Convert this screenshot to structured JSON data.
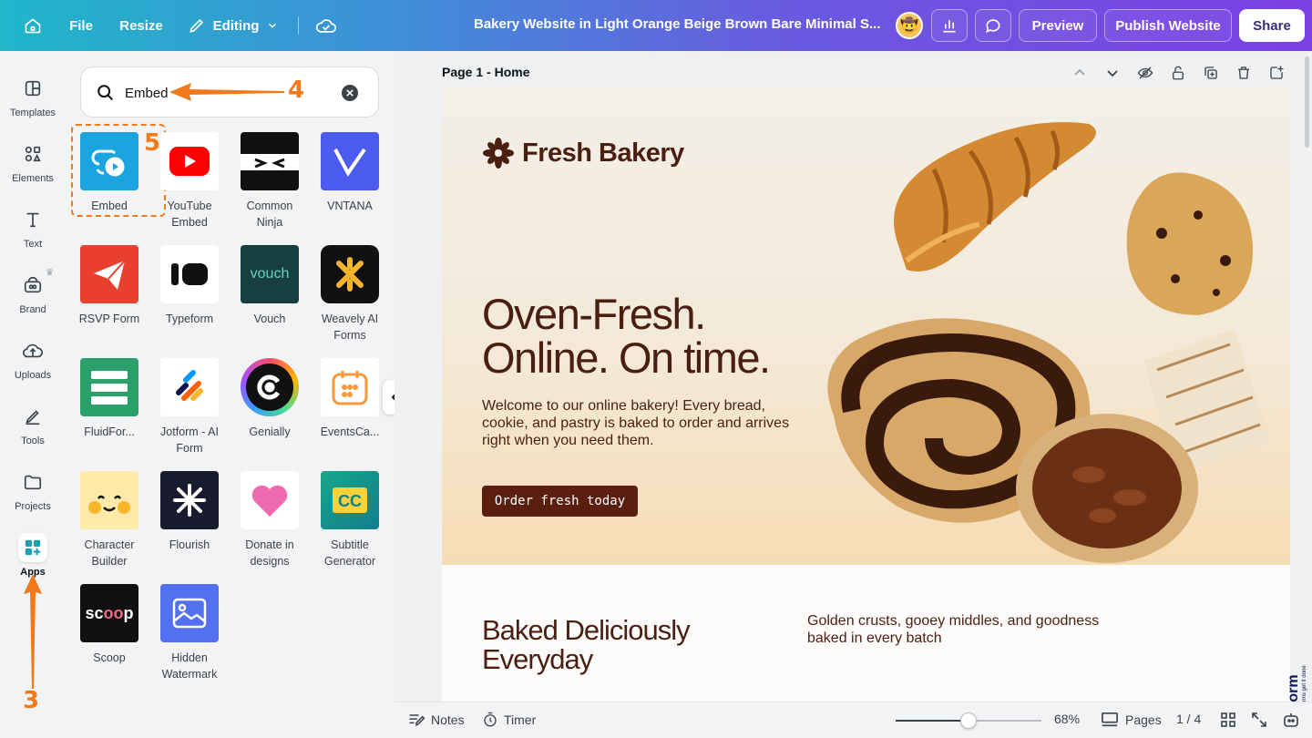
{
  "topbar": {
    "file": "File",
    "resize": "Resize",
    "editing": "Editing",
    "title": "Bakery Website in Light Orange Beige Brown Bare Minimal S...",
    "preview": "Preview",
    "publish": "Publish Website",
    "share": "Share",
    "icons": [
      "home-icon",
      "pencil-icon",
      "chevron-down-icon",
      "cloud-check-icon",
      "insights-icon",
      "comment-icon"
    ]
  },
  "rail": {
    "items": [
      {
        "label": "Templates",
        "icon": "templates-icon"
      },
      {
        "label": "Elements",
        "icon": "elements-icon"
      },
      {
        "label": "Text",
        "icon": "text-icon"
      },
      {
        "label": "Brand",
        "icon": "brand-icon"
      },
      {
        "label": "Uploads",
        "icon": "uploads-icon"
      },
      {
        "label": "Tools",
        "icon": "tools-icon"
      },
      {
        "label": "Projects",
        "icon": "projects-icon"
      },
      {
        "label": "Apps",
        "icon": "apps-icon",
        "active": true
      }
    ]
  },
  "search": {
    "value": "Embed"
  },
  "apps": [
    {
      "name": "Embed"
    },
    {
      "name": "YouTube Embed"
    },
    {
      "name": "Common Ninja"
    },
    {
      "name": "VNTANA"
    },
    {
      "name": "RSVP Form"
    },
    {
      "name": "Typeform"
    },
    {
      "name": "Vouch"
    },
    {
      "name": "Weavely AI Forms"
    },
    {
      "name": "FluidFor..."
    },
    {
      "name": "Jotform - AI Form"
    },
    {
      "name": "Genially"
    },
    {
      "name": "EventsCa..."
    },
    {
      "name": "Character Builder"
    },
    {
      "name": "Flourish"
    },
    {
      "name": "Donate in designs"
    },
    {
      "name": "Subtitle Generator"
    },
    {
      "name": "Scoop"
    },
    {
      "name": "Hidden Watermark"
    }
  ],
  "annotations": {
    "step3": "3",
    "step4": "4",
    "step5": "5",
    "color": "#f07a1a"
  },
  "canvas": {
    "page_label": "Page 1 - Home",
    "logo": "Fresh Bakery",
    "headline_line1": "Oven-Fresh.",
    "headline_line2": "Online. On time.",
    "description": "Welcome to our online bakery! Every bread, cookie, and pastry is baked to order and arrives right when you need them.",
    "cta": "Order fresh today",
    "section_title": "Baked Deliciously Everyday",
    "section_text": "Golden crusts, gooey middles, and goodness baked in every batch",
    "brand_color": "#4a1f12"
  },
  "bottombar": {
    "notes": "Notes",
    "timer": "Timer",
    "zoom": "68%",
    "zoom_level": 0.5,
    "pages": "Pages",
    "page_count": "1 / 4"
  },
  "watermark": {
    "brand": "Jotform",
    "tagline": "Powerful forms get it done"
  }
}
